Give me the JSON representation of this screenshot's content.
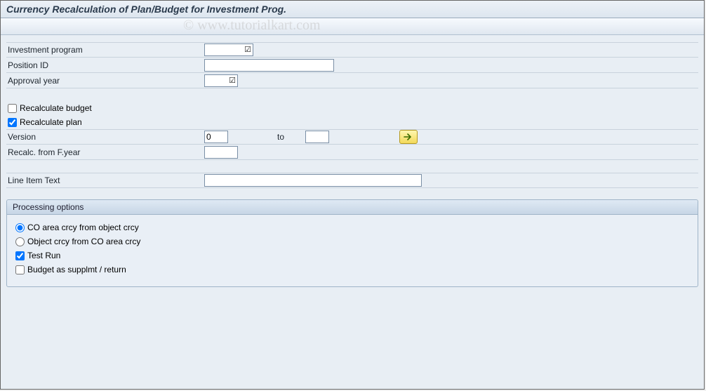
{
  "header": {
    "title": "Currency Recalculation of Plan/Budget for Investment Prog."
  },
  "watermark": "© www.tutorialkart.com",
  "fields": {
    "investment_program": {
      "label": "Investment program",
      "value": "",
      "required": true
    },
    "position_id": {
      "label": "Position ID",
      "value": ""
    },
    "approval_year": {
      "label": "Approval year",
      "value": "",
      "required": true
    },
    "recalc_budget": {
      "label": "Recalculate budget",
      "checked": false
    },
    "recalc_plan": {
      "label": "Recalculate plan",
      "checked": true
    },
    "version": {
      "label": "Version",
      "from": "0",
      "to_label": "to",
      "to": ""
    },
    "recalc_from_fyear": {
      "label": "Recalc. from F.year",
      "value": ""
    },
    "line_item_text": {
      "label": "Line Item Text",
      "value": ""
    }
  },
  "processing": {
    "title": "Processing options",
    "radio_co_from_obj": {
      "label": "CO area crcy from object crcy",
      "checked": true
    },
    "radio_obj_from_co": {
      "label": "Object crcy from CO area crcy",
      "checked": false
    },
    "test_run": {
      "label": "Test Run",
      "checked": true
    },
    "budget_supp_return": {
      "label": "Budget as supplmt / return",
      "checked": false
    }
  }
}
